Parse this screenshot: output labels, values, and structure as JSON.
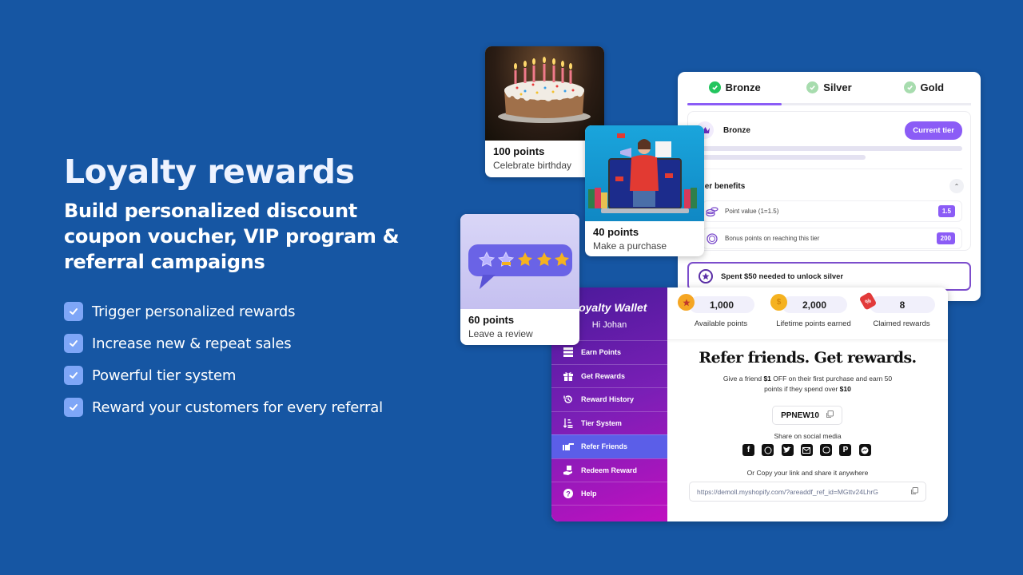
{
  "hero": {
    "title": "Loyalty rewards",
    "subtitle": "Build personalized discount coupon voucher, VIP program & referral campaigns",
    "features": [
      "Trigger personalized rewards",
      "Increase new & repeat sales",
      "Powerful tier system",
      "Reward your customers for every referral"
    ]
  },
  "cards": {
    "birthday": {
      "points": "100 points",
      "action": "Celebrate birthday",
      "image": "birthday-cake"
    },
    "purchase": {
      "points": "40 points",
      "action": "Make a purchase",
      "image": "shopping-woman-laptop"
    },
    "review": {
      "points": "60 points",
      "action": "Leave a review",
      "image": "star-rating-bubble"
    }
  },
  "tiers": {
    "tabs": [
      {
        "label": "Bronze",
        "active": true
      },
      {
        "label": "Silver",
        "active": false
      },
      {
        "label": "Gold",
        "active": false
      }
    ],
    "current": {
      "name": "Bronze",
      "badge": "Current tier"
    },
    "benefits_title": "Tier benefits",
    "benefits": [
      {
        "icon": "coins-icon",
        "label": "Point value (1=1.5)",
        "value": "1.5"
      },
      {
        "icon": "bonus-badge-icon",
        "label": "Bonus points on reaching this tier",
        "value": "200"
      }
    ],
    "unlock_text": "Spent $50 needed to unlock silver",
    "colors": {
      "accent": "#8b5cf6",
      "check_active": "#22c55e",
      "check_inactive": "#a7dcae"
    }
  },
  "wallet": {
    "title": "Loyalty Wallet",
    "greeting": "Hi Johan",
    "menu": [
      {
        "label": "Earn Points",
        "icon": "earn-points-icon",
        "active": false
      },
      {
        "label": "Get Rewards",
        "icon": "gift-icon",
        "active": false
      },
      {
        "label": "Reward History",
        "icon": "history-icon",
        "active": false
      },
      {
        "label": "Tier System",
        "icon": "tier-sort-icon",
        "active": false
      },
      {
        "label": "Refer Friends",
        "icon": "pointing-hand-icon",
        "active": true
      },
      {
        "label": "Redeem Reward",
        "icon": "redeem-hand-icon",
        "active": false
      },
      {
        "label": "Help",
        "icon": "help-icon",
        "active": false
      }
    ],
    "stats": [
      {
        "value": "1,000",
        "label": "Available points",
        "icon": "star-coin-icon"
      },
      {
        "value": "2,000",
        "label": "Lifetime points earned",
        "icon": "dollar-coin-icon"
      },
      {
        "value": "8",
        "label": "Claimed rewards",
        "icon": "discount-tag-icon"
      }
    ],
    "refer": {
      "title": "Refer friends. Get rewards.",
      "desc_1": "Give a friend ",
      "desc_amount": "$1",
      "desc_2": " OFF on their first purchase and earn 50 points if they spend over ",
      "desc_min": "$10",
      "code": "PPNEW10",
      "share_label": "Share on social media",
      "socials": [
        "facebook",
        "whatsapp",
        "twitter",
        "email",
        "viber",
        "pinterest",
        "messenger"
      ],
      "copy_label": "Or Copy your link and share it anywhere",
      "link": "https://demoll.myshopify.com/?areaddf_ref_id=MGttv24LhrG"
    }
  }
}
